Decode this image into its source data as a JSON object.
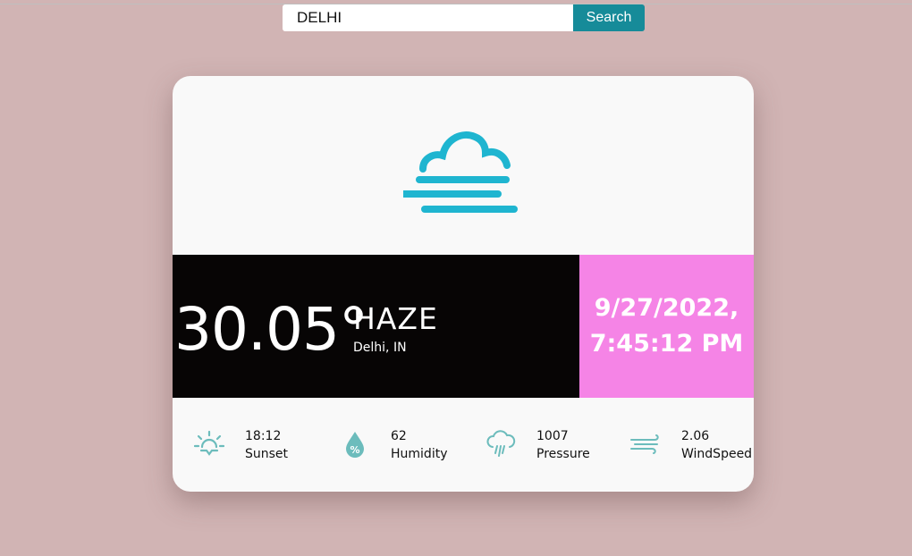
{
  "search": {
    "value": "DELHI",
    "button_label": "Search"
  },
  "weather": {
    "temperature": "30.05°",
    "condition": "HAZE",
    "location": "Delhi, IN",
    "date": "9/27/2022,",
    "time": "7:45:12 PM",
    "icon": "haze-icon"
  },
  "stats": [
    {
      "value": "18:12",
      "label": "Sunset",
      "icon": "sunset-icon"
    },
    {
      "value": "62",
      "label": "Humidity",
      "icon": "humidity-icon"
    },
    {
      "value": "1007",
      "label": "Pressure",
      "icon": "pressure-icon"
    },
    {
      "value": "2.06",
      "label": "WindSpeed",
      "icon": "wind-icon"
    }
  ],
  "colors": {
    "background": "#d1b4b4",
    "accent_teal": "#168b99",
    "icon_cyan": "#1fb5d0",
    "stat_icon": "#6cbcbc",
    "date_panel": "#f584e6"
  }
}
